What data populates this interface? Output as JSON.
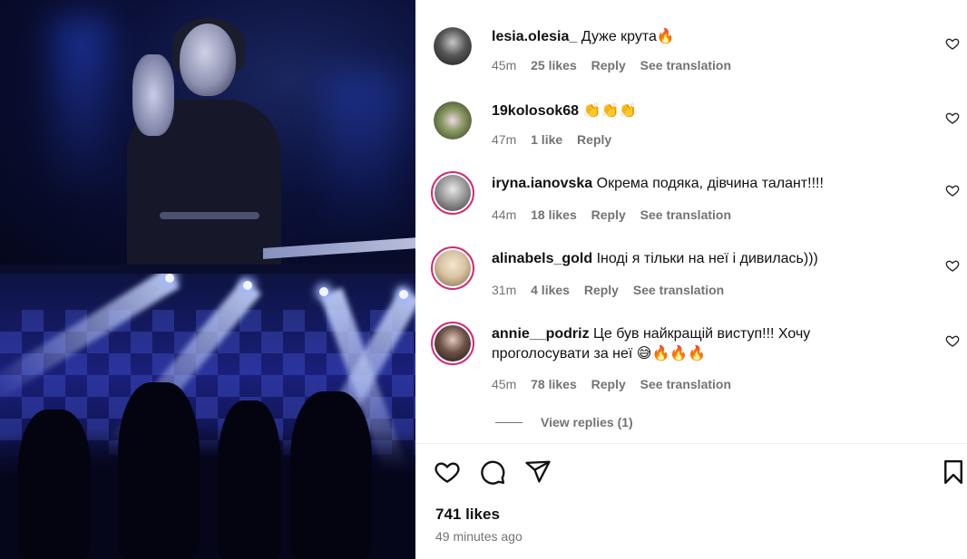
{
  "comments": [
    {
      "username": "lesia.olesia_",
      "text": "Дуже крута🔥",
      "time": "45m",
      "likes": "25 likes",
      "reply": "Reply",
      "translate": "See translation",
      "avatar_color": "#2b2b2b",
      "has_story": false
    },
    {
      "username": "19kolosok68",
      "text": "👏👏👏",
      "time": "47m",
      "likes": "1 like",
      "reply": "Reply",
      "avatar_color": "#6b7a4e",
      "has_story": false
    },
    {
      "username": "iryna.ianovska",
      "text": "Окрема подяка, дівчина талант!!!!",
      "time": "44m",
      "likes": "18 likes",
      "reply": "Reply",
      "translate": "See translation",
      "avatar_color": "#9a9a9a",
      "has_story": true
    },
    {
      "username": "alinabels_gold",
      "text": "Іноді я тільки на неї і дивилась)))",
      "time": "31m",
      "likes": "4 likes",
      "reply": "Reply",
      "translate": "See translation",
      "avatar_color": "#d8c3a3",
      "has_story": true
    },
    {
      "username": "annie__podriz",
      "text": "Це був найкращій виступ!!! Хочу проголосувати за неї 😅🔥🔥🔥",
      "time": "45m",
      "likes": "78 likes",
      "reply": "Reply",
      "translate": "See translation",
      "avatar_color": "#3a2c28",
      "has_story": true
    }
  ],
  "view_replies": "View replies (1)",
  "post": {
    "likes": "741 likes",
    "time_ago": "49 minutes ago"
  },
  "icons": {
    "like": "heart-icon",
    "comment": "comment-icon",
    "share": "share-icon",
    "save": "bookmark-icon"
  },
  "colors": {
    "story_ring": "#d62976",
    "meta_text": "#737373"
  }
}
